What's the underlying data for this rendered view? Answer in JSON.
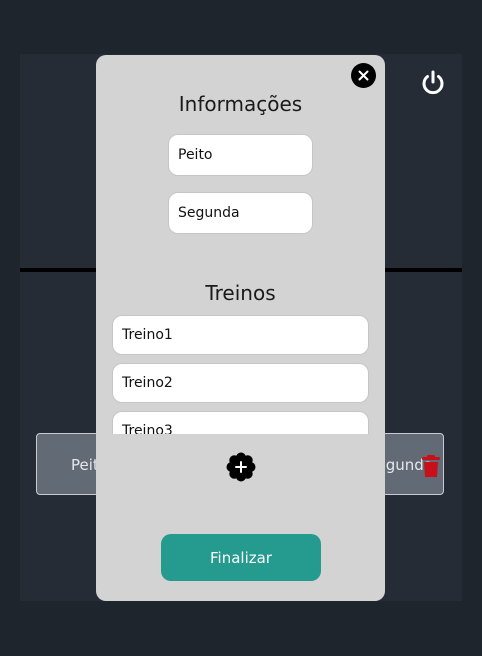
{
  "background": {
    "card": {
      "left_text": "Peito",
      "right_text": "Segunda"
    }
  },
  "modal": {
    "info_title": "Informações",
    "muscle_field": {
      "value": "Peito"
    },
    "day_field": {
      "value": "Segunda"
    },
    "treinos_title": "Treinos",
    "treinos": [
      {
        "label": "Treino1"
      },
      {
        "label": "Treino2"
      },
      {
        "label": "Treino3"
      }
    ],
    "finalizar_label": "Finalizar"
  },
  "colors": {
    "page_bg": "#1f252d",
    "modal_bg": "#d3d3d3",
    "accent": "#259a8e",
    "danger": "#c8101a"
  },
  "icons": [
    "power-icon",
    "close-icon",
    "trash-icon",
    "add-icon"
  ]
}
